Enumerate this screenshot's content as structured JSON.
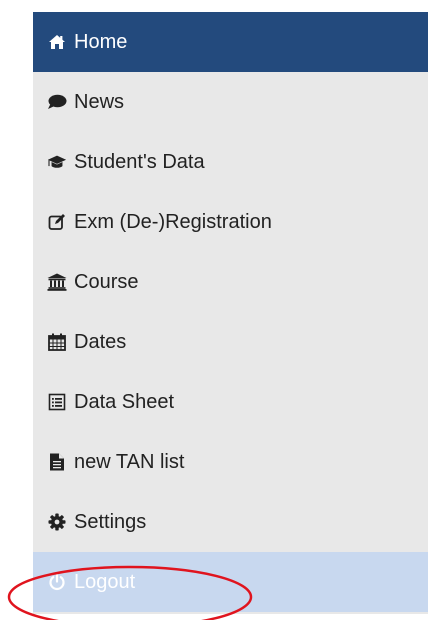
{
  "nav": {
    "items": [
      {
        "label": "Home",
        "icon": "home-icon",
        "active": true
      },
      {
        "label": "News",
        "icon": "speech-bubble-icon"
      },
      {
        "label": "Student's Data",
        "icon": "graduation-cap-icon"
      },
      {
        "label": "Exm (De-)Registration",
        "icon": "edit-icon"
      },
      {
        "label": "Course",
        "icon": "institution-icon"
      },
      {
        "label": "Dates",
        "icon": "calendar-icon"
      },
      {
        "label": "Data Sheet",
        "icon": "list-alt-icon"
      },
      {
        "label": "new TAN list",
        "icon": "file-text-icon"
      },
      {
        "label": "Settings",
        "icon": "gear-icon"
      },
      {
        "label": "Logout",
        "icon": "power-icon",
        "highlighted": true
      }
    ]
  },
  "colors": {
    "nav_background": "#e8e8e8",
    "active_background": "#234a7d",
    "logout_background": "#c8d8ef",
    "annotation_circle": "#e0141e",
    "text": "#222222"
  },
  "annotation": {
    "shape": "ellipse",
    "target": "Logout"
  }
}
